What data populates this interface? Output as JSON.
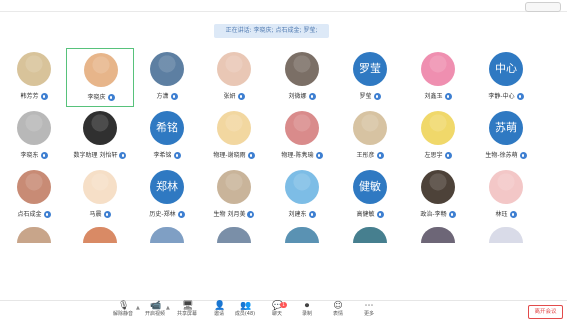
{
  "speaking_bar": "正在讲话: 李晓庆; 点石成金; 罗莹;",
  "participants": [
    {
      "name": "韩芳芳",
      "avatar": "photo",
      "color": "#d8c39a"
    },
    {
      "name": "李晓庆",
      "avatar": "photo",
      "color": "#e7b58a",
      "highlight": true
    },
    {
      "name": "方潇",
      "avatar": "photo",
      "color": "#5d7fa2"
    },
    {
      "name": "张妍",
      "avatar": "photo",
      "color": "#e9c7b5"
    },
    {
      "name": "刘微娜",
      "avatar": "photo",
      "color": "#7b6f66"
    },
    {
      "name": "罗莹",
      "avatar": "text",
      "text": "罗莹"
    },
    {
      "name": "刘鑫玉",
      "avatar": "photo",
      "color": "#ef8fb0"
    },
    {
      "name": "李静-中心",
      "avatar": "text",
      "text": "中心"
    },
    {
      "name": "李晓东",
      "avatar": "photo",
      "color": "#b8b8b8"
    },
    {
      "name": "数字助理 刘怡轩",
      "avatar": "photo",
      "color": "#303030"
    },
    {
      "name": "李希铭",
      "avatar": "text",
      "text": "希铭"
    },
    {
      "name": "物理-谢晓雨",
      "avatar": "photo",
      "color": "#f2d7a0"
    },
    {
      "name": "物理-陈隽瑜",
      "avatar": "photo",
      "color": "#d98b8b"
    },
    {
      "name": "王彤彦",
      "avatar": "photo",
      "color": "#d7c3a2"
    },
    {
      "name": "左思宇",
      "avatar": "photo",
      "color": "#f0d86a"
    },
    {
      "name": "生物-徐苏萌",
      "avatar": "text",
      "text": "苏萌"
    },
    {
      "name": "点石成金",
      "avatar": "photo",
      "color": "#c88b75"
    },
    {
      "name": "马晨",
      "avatar": "photo",
      "color": "#f6dfc7"
    },
    {
      "name": "历史-郑林",
      "avatar": "text",
      "text": "郑林"
    },
    {
      "name": "生物 刘月美",
      "avatar": "photo",
      "color": "#c9b49a"
    },
    {
      "name": "刘建东",
      "avatar": "photo",
      "color": "#7dbde6"
    },
    {
      "name": "高健敏",
      "avatar": "text",
      "text": "健敏"
    },
    {
      "name": "政治-李畅",
      "avatar": "photo",
      "color": "#4d4239"
    },
    {
      "name": "林珏",
      "avatar": "photo",
      "color": "#f3c7c7"
    }
  ],
  "partial_row_colors": [
    "#c8a58a",
    "#d98a65",
    "#7f9fc4",
    "#7a8fa8",
    "#5a92b3",
    "#467f8f",
    "#6d6677",
    "#d9dbe8"
  ],
  "toolbar": {
    "items": [
      {
        "label": "解除静音",
        "icon": "🎙"
      },
      {
        "label": "开启视频",
        "icon": "📹"
      },
      {
        "label": "共享屏幕",
        "icon": "🖥"
      },
      {
        "label": "邀请",
        "icon": "👤"
      },
      {
        "label": "成员(48)",
        "icon": "👥"
      },
      {
        "label": "聊天",
        "icon": "💬",
        "badge": "1"
      },
      {
        "label": "录制",
        "icon": "⏺"
      },
      {
        "label": "表情",
        "icon": "☺"
      },
      {
        "label": "更多",
        "icon": "⋯"
      }
    ],
    "end_label": "离开会议"
  }
}
